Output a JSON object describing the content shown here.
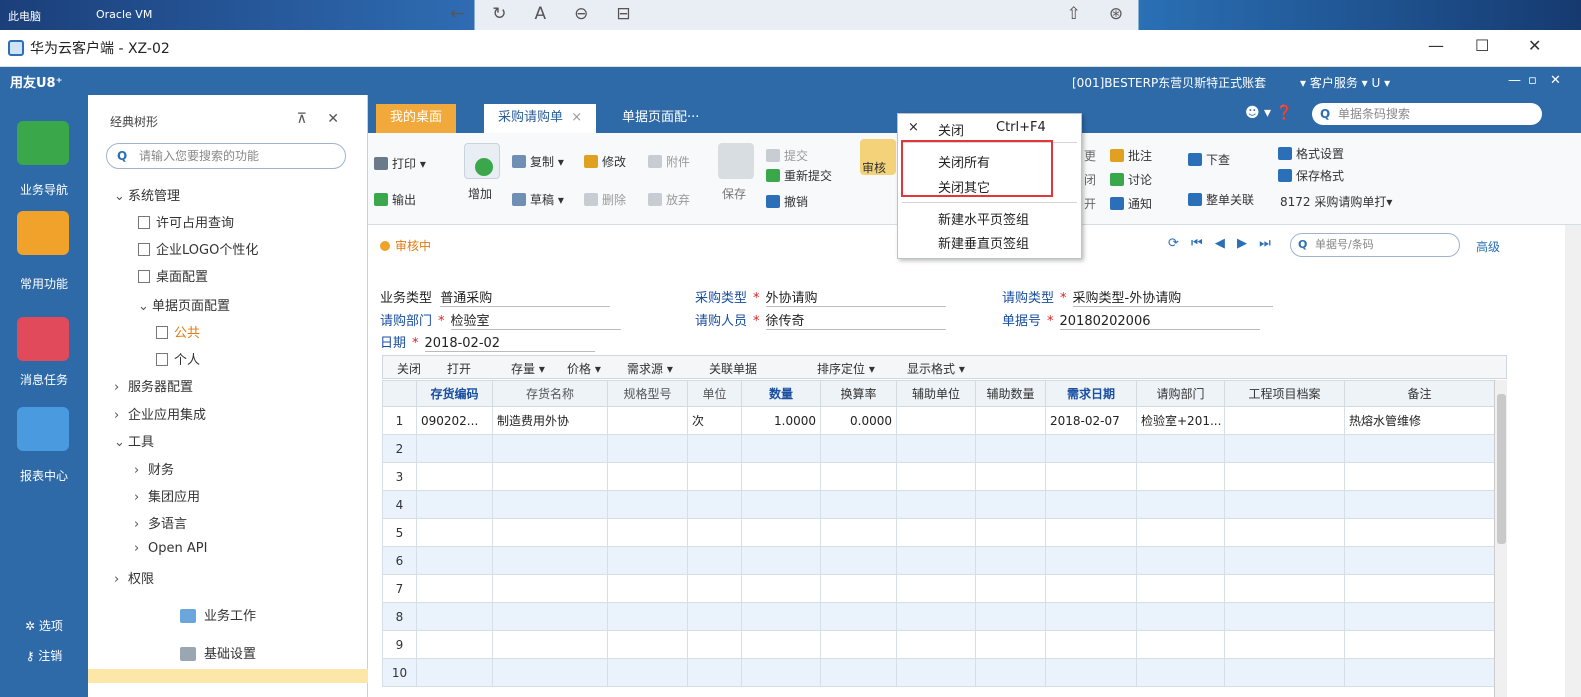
{
  "desktop": {
    "left_labels": [
      "此电脑",
      "Oracle VM"
    ],
    "nav_glyphs": [
      "←",
      "↻",
      "A",
      "⊖",
      "⊟"
    ],
    "right_glyphs": [
      "⇧",
      "⊛"
    ]
  },
  "window": {
    "title": "华为云客户端 - XZ-02",
    "controls": [
      "—",
      "☐",
      "✕"
    ]
  },
  "appbar": {
    "brand": "用友U8⁺",
    "account": "[001]BESTERP东营贝斯特正式账套",
    "service": "▾ 客户服务 ▾ U ▾",
    "window_glyphs": [
      "—",
      "▫",
      "✕"
    ]
  },
  "leftnav": {
    "items": [
      {
        "label": "业务导航",
        "color": "#3aa84a"
      },
      {
        "label": "常用功能",
        "color": "#f0a22a"
      },
      {
        "label": "消息任务",
        "color": "#e04a5a"
      },
      {
        "label": "报表中心",
        "color": "#4a9ae0"
      }
    ],
    "options": "选项",
    "logout": "注销"
  },
  "tree": {
    "header": "经典树形",
    "header_icons": "⊼ ✕",
    "search_placeholder": "请输入您要搜索的功能",
    "items": [
      {
        "label": "系统管理",
        "arrow": "⌄"
      },
      {
        "label": "许可占用查询",
        "arrow": ""
      },
      {
        "label": "企业LOGO个性化",
        "arrow": ""
      },
      {
        "label": "桌面配置",
        "arrow": ""
      },
      {
        "label": "单据页面配置",
        "arrow": "⌄"
      },
      {
        "label": "公共",
        "arrow": ""
      },
      {
        "label": "个人",
        "arrow": ""
      },
      {
        "label": "服务器配置",
        "arrow": "›"
      },
      {
        "label": "企业应用集成",
        "arrow": "›"
      },
      {
        "label": "工具",
        "arrow": "⌄"
      },
      {
        "label": "财务",
        "arrow": "›"
      },
      {
        "label": "集团应用",
        "arrow": "›"
      },
      {
        "label": "多语言",
        "arrow": "›"
      },
      {
        "label": "Open API",
        "arrow": "›"
      },
      {
        "label": "权限",
        "arrow": "›"
      }
    ],
    "bottom": [
      "业务工作",
      "基础设置"
    ]
  },
  "tabs": {
    "home": "我的桌面",
    "active": "采购请购单",
    "active_close": "×",
    "other": "单据页面配···",
    "right_glyphs": "☻ ▾ ❓",
    "search_placeholder": "单据条码搜索"
  },
  "ribbon": {
    "print": "打印",
    "export": "输出",
    "add": "增加",
    "copy": "复制",
    "draft": "草稿",
    "modify": "修改",
    "delete": "删除",
    "attach": "附件",
    "abandon": "放弃",
    "save": "保存",
    "submit": "提交",
    "resubmit": "重新提交",
    "revoke": "撤销",
    "audit": "审核",
    "g1": "更",
    "g2": "闭",
    "g3": "开",
    "approve": "批注",
    "discuss": "讨论",
    "notify": "通知",
    "lookup": "下查",
    "relate": "整单关联",
    "format_set": "格式设置",
    "save_format": "保存格式",
    "template": "8172 采购请购单打▾"
  },
  "status": {
    "text": "审核中",
    "nav": "⟳ ⏮ ◀ ▶ ⏭",
    "search_placeholder": "单据号/条码",
    "advanced": "高级"
  },
  "form": {
    "biz_type_label": "业务类型",
    "biz_type": "普通采购",
    "purchase_type_label": "采购类型",
    "purchase_type": "外协请购",
    "req_type_label": "请购类型",
    "req_type": "采购类型-外协请购",
    "dept_label": "请购部门",
    "dept": "检验室",
    "person_label": "请购人员",
    "person": "徐传奇",
    "doc_no_label": "单据号",
    "doc_no": "20180202006",
    "date_label": "日期",
    "date": "2018-02-02",
    "req": "*"
  },
  "gridbar": {
    "close": "关闭",
    "open": "打开",
    "stock": "存量 ▾",
    "price": "价格 ▾",
    "demand": "需求源 ▾",
    "link": "关联单据",
    "sort": "排序定位 ▾",
    "display": "显示格式 ▾"
  },
  "grid": {
    "columns": [
      "",
      "存货编码",
      "存货名称",
      "规格型号",
      "单位",
      "数量",
      "换算率",
      "辅助单位",
      "辅助数量",
      "需求日期",
      "请购部门",
      "工程项目档案",
      "备注"
    ],
    "bold_columns": [
      1,
      5,
      6,
      7,
      8,
      9,
      10,
      11,
      12
    ],
    "blue_columns": [
      1,
      5,
      9
    ],
    "rows": [
      [
        "1",
        "090202...",
        "制造费用外协",
        "",
        "次",
        "1.0000",
        "0.0000",
        "",
        "",
        "2018-02-07",
        "检验室+201...",
        "",
        "热熔水管维修"
      ],
      [
        "2",
        "",
        "",
        "",
        "",
        "",
        "",
        "",
        "",
        "",
        "",
        "",
        ""
      ],
      [
        "3",
        "",
        "",
        "",
        "",
        "",
        "",
        "",
        "",
        "",
        "",
        "",
        ""
      ],
      [
        "4",
        "",
        "",
        "",
        "",
        "",
        "",
        "",
        "",
        "",
        "",
        "",
        ""
      ],
      [
        "5",
        "",
        "",
        "",
        "",
        "",
        "",
        "",
        "",
        "",
        "",
        "",
        ""
      ],
      [
        "6",
        "",
        "",
        "",
        "",
        "",
        "",
        "",
        "",
        "",
        "",
        "",
        ""
      ],
      [
        "7",
        "",
        "",
        "",
        "",
        "",
        "",
        "",
        "",
        "",
        "",
        "",
        ""
      ],
      [
        "8",
        "",
        "",
        "",
        "",
        "",
        "",
        "",
        "",
        "",
        "",
        "",
        ""
      ],
      [
        "9",
        "",
        "",
        "",
        "",
        "",
        "",
        "",
        "",
        "",
        "",
        "",
        ""
      ],
      [
        "10",
        "",
        "",
        "",
        "",
        "",
        "",
        "",
        "",
        "",
        "",
        "",
        ""
      ]
    ]
  },
  "context_menu": {
    "close_glyph": "×",
    "close": "关闭",
    "close_shortcut": "Ctrl+F4",
    "close_all": "关闭所有",
    "close_others": "关闭其它",
    "new_h_group": "新建水平页签组",
    "new_v_group": "新建垂直页签组"
  },
  "colors": {
    "primary": "#2e6aa8",
    "home_tab": "#f0a93a",
    "highlight": "#e0373a"
  }
}
